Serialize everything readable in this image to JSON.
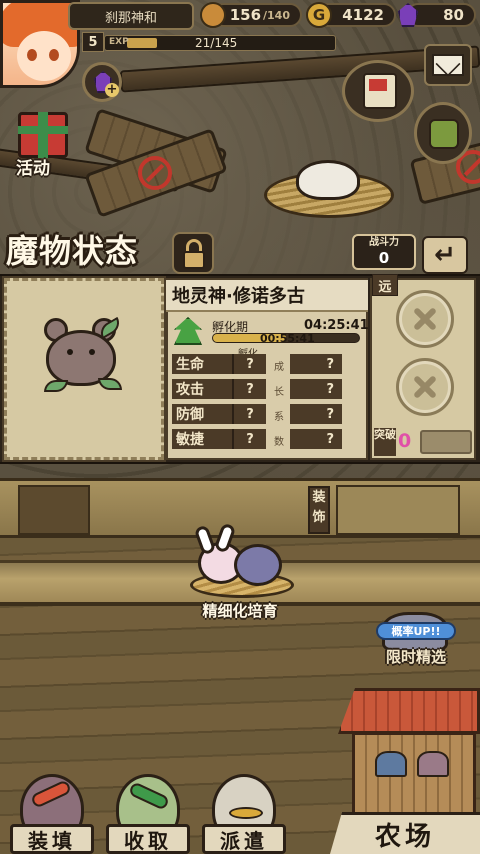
{
  "player": {
    "name": "刹那神和",
    "level": "5",
    "exp_label": "EXP",
    "exp_text": "21/145",
    "exp_progress": 0.145
  },
  "resources": {
    "bread": {
      "value": "156",
      "max": "/140",
      "icon": "bread-icon",
      "color": "#c98b3a"
    },
    "gold": {
      "value": "4122",
      "icon": "gold-coin-icon",
      "color": "#d9a93a"
    },
    "gem": {
      "value": "80",
      "icon": "purple-gem-icon",
      "color": "#7a3fb8"
    }
  },
  "buttons": {
    "activity": "活动",
    "mail_icon": "envelope-icon",
    "add_gem_icon": "gem-plus-icon"
  },
  "status": {
    "title": "魔物状态",
    "power_label": "战斗力",
    "power_value": "0",
    "back_icon": "back-arrow-icon"
  },
  "monster": {
    "name": "地灵神·修诺多古",
    "stage_label": "孵化期",
    "stage_time": "04:25:41",
    "hatch_small": "孵化",
    "hatch_remaining": "00:55:41",
    "hatch_progress": 0.5,
    "stats": [
      {
        "label": "生命",
        "value": "?",
        "growth_char": "成",
        "growth": "?"
      },
      {
        "label": "攻击",
        "value": "?",
        "growth_char": "长",
        "growth": "?"
      },
      {
        "label": "防御",
        "value": "?",
        "growth_char": "系",
        "growth": "?"
      },
      {
        "label": "敏捷",
        "value": "?",
        "growth_char": "数",
        "growth": "?"
      }
    ],
    "range_tag": "远",
    "breakthrough_label": "突破",
    "breakthrough_value": "0"
  },
  "farm": {
    "equip_tag": "装饰",
    "incubator_label": "精细化培育",
    "limited_badge": "概率UP!!",
    "limited_label": "限时精选",
    "farm_label": "农场"
  },
  "bottom_nav": [
    {
      "label": "装填",
      "icon": "egg-load-icon",
      "color": "#8c6f7a"
    },
    {
      "label": "收取",
      "icon": "egg-collect-icon",
      "color": "#a8c08a"
    },
    {
      "label": "派遣",
      "icon": "egg-dispatch-icon",
      "color": "#d8d2c3"
    }
  ]
}
